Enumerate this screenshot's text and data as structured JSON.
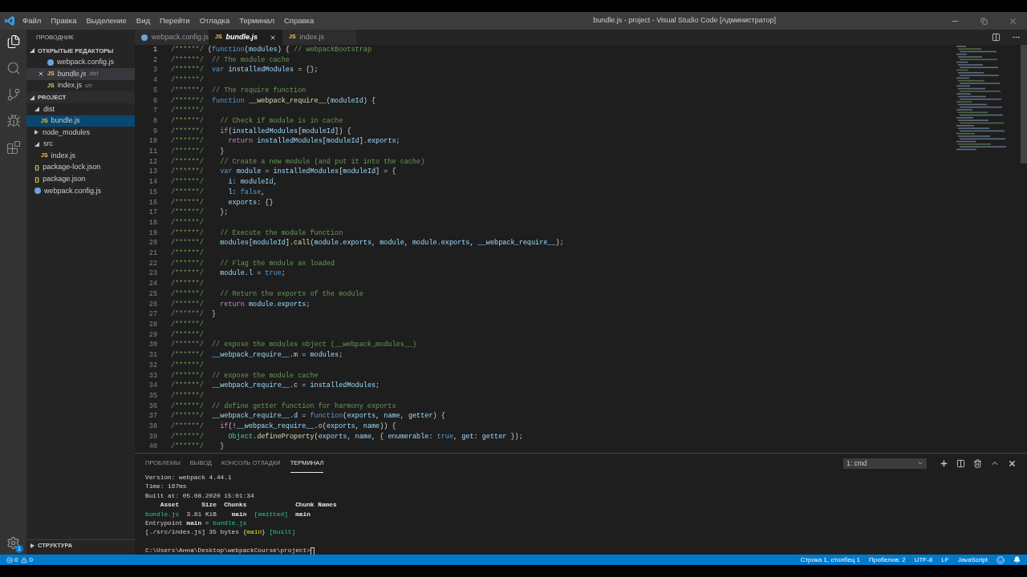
{
  "window": {
    "title": "bundle.js - project - Visual Studio Code [Администратор]"
  },
  "menu": [
    "Файл",
    "Правка",
    "Выделение",
    "Вид",
    "Перейти",
    "Отладка",
    "Терминал",
    "Справка"
  ],
  "activity_bar": {
    "items": [
      {
        "selected": true
      },
      {
        "selected": false
      },
      {
        "selected": false
      },
      {
        "selected": false
      },
      {
        "selected": false
      }
    ],
    "settings_badge": "1"
  },
  "sidebar": {
    "title": "ПРОВОДНИК",
    "open_editors": {
      "label": "ОТКРЫТЫЕ РЕДАКТОРЫ",
      "expanded": true,
      "items": [
        {
          "name": "webpack.config.js",
          "kind": "webpack",
          "selected": false
        },
        {
          "name": "bundle.js",
          "glyph": "JS",
          "kind": "js",
          "dir": "dist",
          "selected": true
        },
        {
          "name": "index.js",
          "glyph": "JS",
          "kind": "js",
          "dir": "src",
          "selected": false
        }
      ]
    },
    "project": {
      "label": "PROJECT",
      "expanded": true,
      "children": [
        {
          "name": "dist",
          "kind": "folder",
          "expanded": true,
          "children": [
            {
              "name": "bundle.js",
              "kind": "js",
              "glyph": "JS",
              "selected": true
            }
          ]
        },
        {
          "name": "node_modules",
          "kind": "folder",
          "expanded": false
        },
        {
          "name": "src",
          "kind": "folder",
          "expanded": true,
          "children": [
            {
              "name": "index.js",
              "kind": "js",
              "glyph": "JS",
              "selected": false
            }
          ]
        },
        {
          "name": "package-lock.json",
          "kind": "json",
          "glyph": "{}",
          "selected": false
        },
        {
          "name": "package.json",
          "kind": "json",
          "glyph": "{}",
          "selected": false
        },
        {
          "name": "webpack.config.js",
          "kind": "webpack",
          "selected": false
        }
      ]
    },
    "outline": {
      "label": "СТРУКТУРА",
      "expanded": false
    }
  },
  "tabs": [
    {
      "label": "webpack.config.js",
      "kind": "webpack",
      "selected": false
    },
    {
      "label": "bundle.js",
      "kind": "js",
      "glyph": "JS",
      "selected": true
    },
    {
      "label": "index.js",
      "kind": "js",
      "glyph": "JS",
      "selected": false
    }
  ],
  "editor": {
    "lines": [
      {
        "number": "1",
        "tokens": [
          {
            "kind": "comment",
            "text": "/******/"
          },
          {
            "kind": "plain",
            "text": " ("
          },
          {
            "kind": "keyword",
            "text": "function"
          },
          {
            "kind": "plain",
            "text": "("
          },
          {
            "kind": "var",
            "text": "modules"
          },
          {
            "kind": "plain",
            "text": ") { "
          },
          {
            "kind": "comment",
            "text": "// webpackBootstrap"
          }
        ]
      },
      {
        "number": "2",
        "tokens": [
          {
            "kind": "comment",
            "text": "/******/  // The module cache"
          }
        ]
      },
      {
        "number": "3",
        "tokens": [
          {
            "kind": "comment",
            "text": "/******/"
          },
          {
            "kind": "keyword",
            "text": "  var"
          },
          {
            "kind": "var",
            "text": " installedModules"
          },
          {
            "kind": "plain",
            "text": " = {};"
          }
        ]
      },
      {
        "number": "4",
        "tokens": [
          {
            "kind": "comment",
            "text": "/******/"
          }
        ]
      },
      {
        "number": "5",
        "tokens": [
          {
            "kind": "comment",
            "text": "/******/  // The require function"
          }
        ]
      },
      {
        "number": "6",
        "tokens": [
          {
            "kind": "comment",
            "text": "/******/"
          },
          {
            "kind": "keyword",
            "text": "  function"
          },
          {
            "kind": "func",
            "text": " __webpack_require__"
          },
          {
            "kind": "plain",
            "text": "("
          },
          {
            "kind": "var",
            "text": "moduleId"
          },
          {
            "kind": "plain",
            "text": ") {"
          }
        ]
      },
      {
        "number": "7",
        "tokens": [
          {
            "kind": "comment",
            "text": "/******/"
          }
        ]
      },
      {
        "number": "8",
        "tokens": [
          {
            "kind": "comment",
            "text": "/******/    // Check if module is in cache"
          }
        ]
      },
      {
        "number": "9",
        "tokens": [
          {
            "kind": "comment",
            "text": "/******/"
          },
          {
            "kind": "control",
            "text": "    if"
          },
          {
            "kind": "plain",
            "text": "("
          },
          {
            "kind": "var",
            "text": "installedModules"
          },
          {
            "kind": "plain",
            "text": "["
          },
          {
            "kind": "var",
            "text": "moduleId"
          },
          {
            "kind": "plain",
            "text": "]) {"
          }
        ]
      },
      {
        "number": "10",
        "tokens": [
          {
            "kind": "comment",
            "text": "/******/"
          },
          {
            "kind": "control",
            "text": "      return"
          },
          {
            "kind": "var",
            "text": " installedModules"
          },
          {
            "kind": "plain",
            "text": "["
          },
          {
            "kind": "var",
            "text": "moduleId"
          },
          {
            "kind": "plain",
            "text": "]."
          },
          {
            "kind": "var",
            "text": "exports"
          },
          {
            "kind": "plain",
            "text": ";"
          }
        ]
      },
      {
        "number": "11",
        "tokens": [
          {
            "kind": "comment",
            "text": "/******/"
          },
          {
            "kind": "plain",
            "text": "    }"
          }
        ]
      },
      {
        "number": "12",
        "tokens": [
          {
            "kind": "comment",
            "text": "/******/    // Create a new module (and put it into the cache)"
          }
        ]
      },
      {
        "number": "13",
        "tokens": [
          {
            "kind": "comment",
            "text": "/******/"
          },
          {
            "kind": "keyword",
            "text": "    var"
          },
          {
            "kind": "var",
            "text": " module"
          },
          {
            "kind": "plain",
            "text": " = "
          },
          {
            "kind": "var",
            "text": "installedModules"
          },
          {
            "kind": "plain",
            "text": "["
          },
          {
            "kind": "var",
            "text": "moduleId"
          },
          {
            "kind": "plain",
            "text": "] = {"
          }
        ]
      },
      {
        "number": "14",
        "tokens": [
          {
            "kind": "comment",
            "text": "/******/"
          },
          {
            "kind": "var",
            "text": "      i"
          },
          {
            "kind": "plain",
            "text": ": "
          },
          {
            "kind": "var",
            "text": "moduleId"
          },
          {
            "kind": "plain",
            "text": ","
          }
        ]
      },
      {
        "number": "15",
        "tokens": [
          {
            "kind": "comment",
            "text": "/******/"
          },
          {
            "kind": "var",
            "text": "      l"
          },
          {
            "kind": "plain",
            "text": ": "
          },
          {
            "kind": "keyword",
            "text": "false"
          },
          {
            "kind": "plain",
            "text": ","
          }
        ]
      },
      {
        "number": "16",
        "tokens": [
          {
            "kind": "comment",
            "text": "/******/"
          },
          {
            "kind": "var",
            "text": "      exports"
          },
          {
            "kind": "plain",
            "text": ": {}"
          }
        ]
      },
      {
        "number": "17",
        "tokens": [
          {
            "kind": "comment",
            "text": "/******/"
          },
          {
            "kind": "plain",
            "text": "    };"
          }
        ]
      },
      {
        "number": "18",
        "tokens": [
          {
            "kind": "comment",
            "text": "/******/"
          }
        ]
      },
      {
        "number": "19",
        "tokens": [
          {
            "kind": "comment",
            "text": "/******/    // Execute the module function"
          }
        ]
      },
      {
        "number": "20",
        "tokens": [
          {
            "kind": "comment",
            "text": "/******/"
          },
          {
            "kind": "var",
            "text": "    modules"
          },
          {
            "kind": "plain",
            "text": "["
          },
          {
            "kind": "var",
            "text": "moduleId"
          },
          {
            "kind": "plain",
            "text": "]."
          },
          {
            "kind": "func",
            "text": "call"
          },
          {
            "kind": "plain",
            "text": "("
          },
          {
            "kind": "var",
            "text": "module"
          },
          {
            "kind": "plain",
            "text": "."
          },
          {
            "kind": "var",
            "text": "exports"
          },
          {
            "kind": "plain",
            "text": ", "
          },
          {
            "kind": "var",
            "text": "module"
          },
          {
            "kind": "plain",
            "text": ", "
          },
          {
            "kind": "var",
            "text": "module"
          },
          {
            "kind": "plain",
            "text": "."
          },
          {
            "kind": "var",
            "text": "exports"
          },
          {
            "kind": "plain",
            "text": ", "
          },
          {
            "kind": "var",
            "text": "__webpack_require__"
          },
          {
            "kind": "plain",
            "text": ");"
          }
        ]
      },
      {
        "number": "21",
        "tokens": [
          {
            "kind": "comment",
            "text": "/******/"
          }
        ]
      },
      {
        "number": "22",
        "tokens": [
          {
            "kind": "comment",
            "text": "/******/    // Flag the module as loaded"
          }
        ]
      },
      {
        "number": "23",
        "tokens": [
          {
            "kind": "comment",
            "text": "/******/"
          },
          {
            "kind": "var",
            "text": "    module"
          },
          {
            "kind": "plain",
            "text": "."
          },
          {
            "kind": "var",
            "text": "l"
          },
          {
            "kind": "plain",
            "text": " = "
          },
          {
            "kind": "keyword",
            "text": "true"
          },
          {
            "kind": "plain",
            "text": ";"
          }
        ]
      },
      {
        "number": "24",
        "tokens": [
          {
            "kind": "comment",
            "text": "/******/"
          }
        ]
      },
      {
        "number": "25",
        "tokens": [
          {
            "kind": "comment",
            "text": "/******/    // Return the exports of the module"
          }
        ]
      },
      {
        "number": "26",
        "tokens": [
          {
            "kind": "comment",
            "text": "/******/"
          },
          {
            "kind": "control",
            "text": "    return"
          },
          {
            "kind": "var",
            "text": " module"
          },
          {
            "kind": "plain",
            "text": "."
          },
          {
            "kind": "var",
            "text": "exports"
          },
          {
            "kind": "plain",
            "text": ";"
          }
        ]
      },
      {
        "number": "27",
        "tokens": [
          {
            "kind": "comment",
            "text": "/******/"
          },
          {
            "kind": "plain",
            "text": "  }"
          }
        ]
      },
      {
        "number": "28",
        "tokens": [
          {
            "kind": "comment",
            "text": "/******/"
          }
        ]
      },
      {
        "number": "29",
        "tokens": [
          {
            "kind": "comment",
            "text": "/******/"
          }
        ]
      },
      {
        "number": "30",
        "tokens": [
          {
            "kind": "comment",
            "text": "/******/  // expose the modules object (__webpack_modules__)"
          }
        ]
      },
      {
        "number": "31",
        "tokens": [
          {
            "kind": "comment",
            "text": "/******/"
          },
          {
            "kind": "var",
            "text": "  __webpack_require__"
          },
          {
            "kind": "plain",
            "text": "."
          },
          {
            "kind": "var",
            "text": "m"
          },
          {
            "kind": "plain",
            "text": " = "
          },
          {
            "kind": "var",
            "text": "modules"
          },
          {
            "kind": "plain",
            "text": ";"
          }
        ]
      },
      {
        "number": "32",
        "tokens": [
          {
            "kind": "comment",
            "text": "/******/"
          }
        ]
      },
      {
        "number": "33",
        "tokens": [
          {
            "kind": "comment",
            "text": "/******/  // expose the module cache"
          }
        ]
      },
      {
        "number": "34",
        "tokens": [
          {
            "kind": "comment",
            "text": "/******/"
          },
          {
            "kind": "var",
            "text": "  __webpack_require__"
          },
          {
            "kind": "plain",
            "text": "."
          },
          {
            "kind": "var",
            "text": "c"
          },
          {
            "kind": "plain",
            "text": " = "
          },
          {
            "kind": "var",
            "text": "installedModules"
          },
          {
            "kind": "plain",
            "text": ";"
          }
        ]
      },
      {
        "number": "35",
        "tokens": [
          {
            "kind": "comment",
            "text": "/******/"
          }
        ]
      },
      {
        "number": "36",
        "tokens": [
          {
            "kind": "comment",
            "text": "/******/  // define getter function for harmony exports"
          }
        ]
      },
      {
        "number": "37",
        "tokens": [
          {
            "kind": "comment",
            "text": "/******/"
          },
          {
            "kind": "var",
            "text": "  __webpack_require__"
          },
          {
            "kind": "plain",
            "text": "."
          },
          {
            "kind": "var",
            "text": "d"
          },
          {
            "kind": "plain",
            "text": " = "
          },
          {
            "kind": "keyword",
            "text": "function"
          },
          {
            "kind": "plain",
            "text": "("
          },
          {
            "kind": "var",
            "text": "exports"
          },
          {
            "kind": "plain",
            "text": ", "
          },
          {
            "kind": "var",
            "text": "name"
          },
          {
            "kind": "plain",
            "text": ", "
          },
          {
            "kind": "var",
            "text": "getter"
          },
          {
            "kind": "plain",
            "text": ") {"
          }
        ]
      },
      {
        "number": "38",
        "tokens": [
          {
            "kind": "comment",
            "text": "/******/"
          },
          {
            "kind": "control",
            "text": "    if"
          },
          {
            "kind": "plain",
            "text": "(!"
          },
          {
            "kind": "var",
            "text": "__webpack_require__"
          },
          {
            "kind": "plain",
            "text": "."
          },
          {
            "kind": "func",
            "text": "o"
          },
          {
            "kind": "plain",
            "text": "("
          },
          {
            "kind": "var",
            "text": "exports"
          },
          {
            "kind": "plain",
            "text": ", "
          },
          {
            "kind": "var",
            "text": "name"
          },
          {
            "kind": "plain",
            "text": ")) {"
          }
        ]
      },
      {
        "number": "39",
        "tokens": [
          {
            "kind": "comment",
            "text": "/******/"
          },
          {
            "kind": "type",
            "text": "      Object"
          },
          {
            "kind": "plain",
            "text": "."
          },
          {
            "kind": "func",
            "text": "defineProperty"
          },
          {
            "kind": "plain",
            "text": "("
          },
          {
            "kind": "var",
            "text": "exports"
          },
          {
            "kind": "plain",
            "text": ", "
          },
          {
            "kind": "var",
            "text": "name"
          },
          {
            "kind": "plain",
            "text": ", { "
          },
          {
            "kind": "var",
            "text": "enumerable"
          },
          {
            "kind": "plain",
            "text": ": "
          },
          {
            "kind": "keyword",
            "text": "true"
          },
          {
            "kind": "plain",
            "text": ", "
          },
          {
            "kind": "var",
            "text": "get"
          },
          {
            "kind": "plain",
            "text": ": "
          },
          {
            "kind": "var",
            "text": "getter"
          },
          {
            "kind": "plain",
            "text": " });"
          }
        ]
      },
      {
        "number": "40",
        "tokens": [
          {
            "kind": "comment",
            "text": "/******/"
          },
          {
            "kind": "plain",
            "text": "    }"
          }
        ]
      }
    ]
  },
  "panel": {
    "tabs": [
      {
        "label": "ПРОБЛЕМЫ",
        "selected": false
      },
      {
        "label": "ВЫВОД",
        "selected": false
      },
      {
        "label": "КОНСОЛЬ ОТЛАДКИ",
        "selected": false
      },
      {
        "label": "ТЕРМИНАЛ",
        "selected": true
      }
    ],
    "terminal_select": "1: cmd",
    "terminal": [
      {
        "kind": "output",
        "tokens": [
          {
            "kind": "plain",
            "text": "Version: webpack 4.44.1"
          }
        ]
      },
      {
        "kind": "output",
        "tokens": [
          {
            "kind": "plain",
            "text": "Time: 167ms"
          }
        ]
      },
      {
        "kind": "output",
        "tokens": [
          {
            "kind": "plain",
            "text": "Built at: 05.08.2020 15:01:34"
          }
        ]
      },
      {
        "kind": "output",
        "tokens": [
          {
            "kind": "bold",
            "text": "    Asset      Size  Chunks             Chunk Names"
          }
        ]
      },
      {
        "kind": "output",
        "tokens": [
          {
            "kind": "green",
            "text": "bundle.js"
          },
          {
            "kind": "plain",
            "text": "  3.81 KiB    "
          },
          {
            "kind": "bold",
            "text": "main"
          },
          {
            "kind": "green",
            "text": "  [emitted]"
          },
          {
            "kind": "bold",
            "text": "  main"
          }
        ]
      },
      {
        "kind": "output",
        "tokens": [
          {
            "kind": "plain",
            "text": "Entrypoint "
          },
          {
            "kind": "bold",
            "text": "main"
          },
          {
            "kind": "plain",
            "text": " = "
          },
          {
            "kind": "green",
            "text": "bundle.js"
          }
        ]
      },
      {
        "kind": "output",
        "tokens": [
          {
            "kind": "plain",
            "text": "[./src/index.js] 35 bytes {"
          },
          {
            "kind": "yellow",
            "text": "main"
          },
          {
            "kind": "plain",
            "text": "} "
          },
          {
            "kind": "green",
            "text": "[built]"
          }
        ]
      },
      {
        "kind": "prompt",
        "tokens": [
          {
            "kind": "plain",
            "text": "C:\\Users\\Анна\\Desktop\\webpackCourse\\project>"
          }
        ]
      }
    ]
  },
  "status_bar": {
    "errors": "0",
    "warnings": "0",
    "items": [
      "Строка 1, столбец 1",
      "Пробелов: 2",
      "UTF-8",
      "LF",
      "JavaScript"
    ]
  }
}
